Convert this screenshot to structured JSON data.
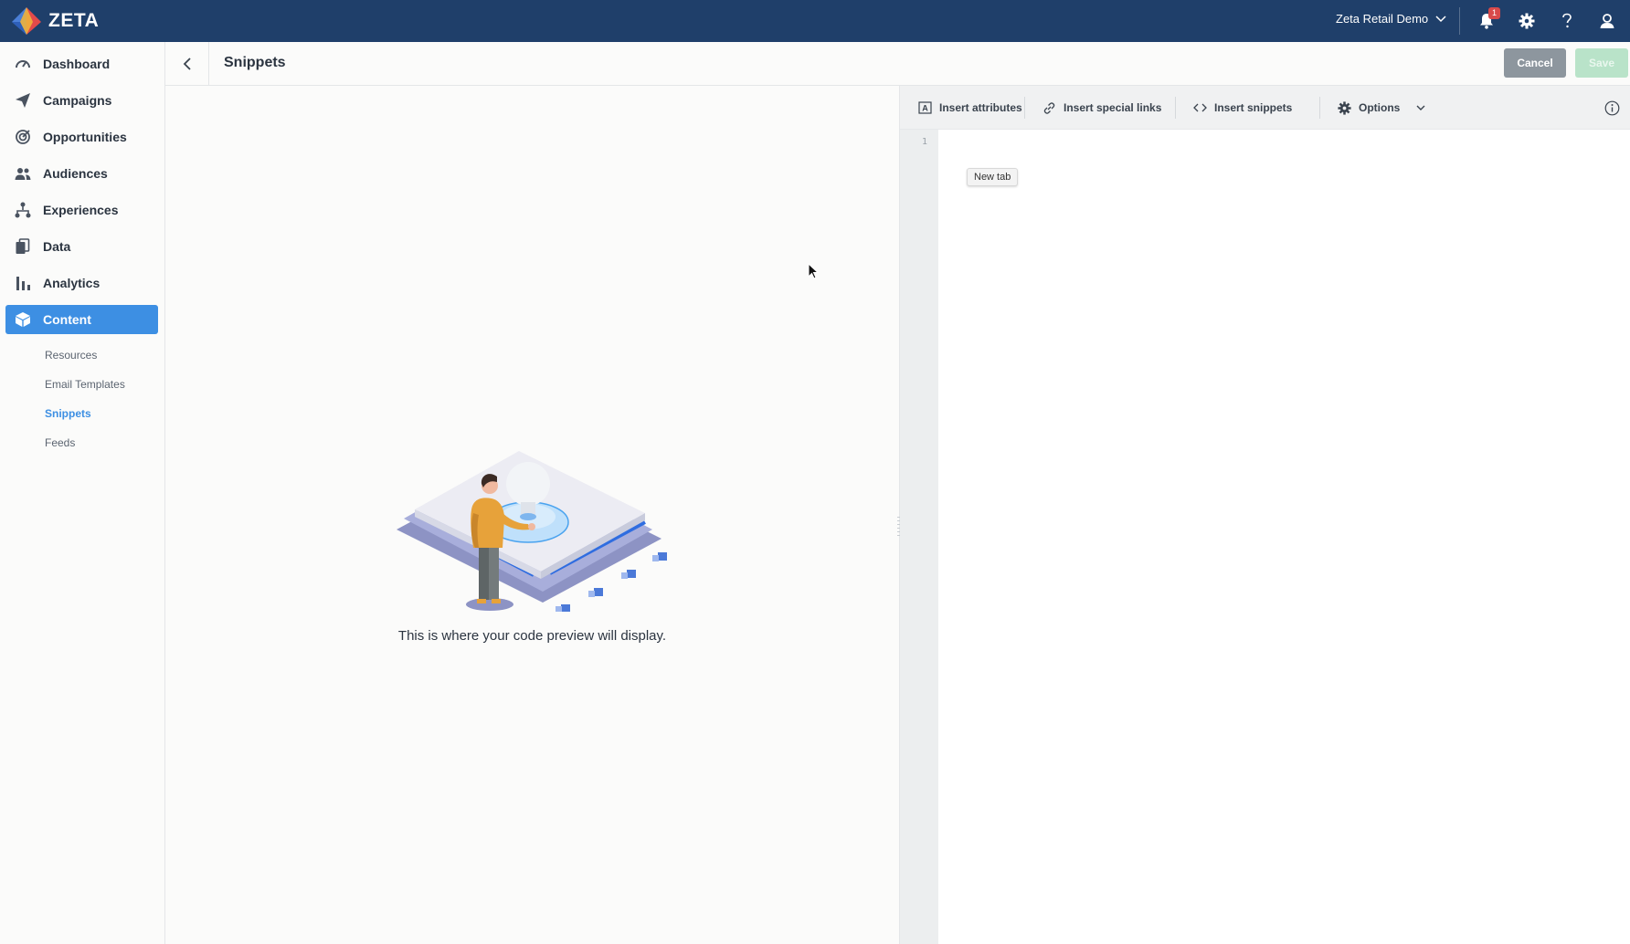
{
  "app": {
    "brand": "ZETA",
    "account": "Zeta Retail Demo",
    "notification_count": "1",
    "colors": {
      "topbar": "#1f3f6a",
      "accent": "#3d8fe3",
      "save_disabled": "#b9e3c9",
      "cancel": "#8d969e"
    }
  },
  "topbar": {
    "icons": [
      "bell-icon",
      "gear-icon",
      "help-icon",
      "user-icon"
    ]
  },
  "sidebar": {
    "items": [
      {
        "label": "Dashboard",
        "icon": "dashboard-icon"
      },
      {
        "label": "Campaigns",
        "icon": "paper-plane-icon"
      },
      {
        "label": "Opportunities",
        "icon": "target-icon"
      },
      {
        "label": "Audiences",
        "icon": "people-icon"
      },
      {
        "label": "Experiences",
        "icon": "hierarchy-icon"
      },
      {
        "label": "Data",
        "icon": "files-icon"
      },
      {
        "label": "Analytics",
        "icon": "bar-chart-icon"
      },
      {
        "label": "Content",
        "icon": "cube-icon",
        "active": true
      }
    ],
    "subitems": [
      {
        "label": "Resources"
      },
      {
        "label": "Email Templates"
      },
      {
        "label": "Snippets",
        "active": true
      },
      {
        "label": "Feeds"
      }
    ]
  },
  "header": {
    "title": "Snippets",
    "cancel_label": "Cancel",
    "save_label": "Save"
  },
  "preview": {
    "empty_message": "This is where your code preview will display."
  },
  "editor": {
    "toolbar": {
      "insert_attributes": "Insert attributes",
      "insert_special_links": "Insert special links",
      "insert_snippets": "Insert snippets",
      "options": "Options"
    },
    "line_numbers": [
      "1"
    ],
    "tooltip": "New tab"
  }
}
